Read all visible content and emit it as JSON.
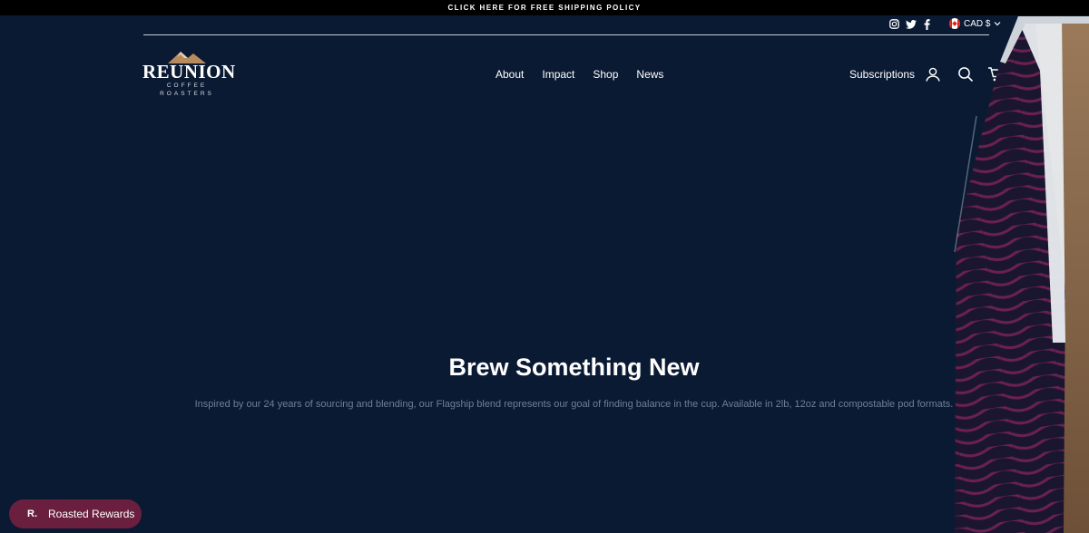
{
  "announcement": {
    "text": "CLICK HERE FOR FREE SHIPPING POLICY"
  },
  "utility": {
    "social": [
      "instagram-icon",
      "twitter-icon",
      "facebook-icon"
    ],
    "currency": "CAD $"
  },
  "logo": {
    "wordmark": "REUNION",
    "line1": "COFFEE",
    "line2": "ROASTERS"
  },
  "nav": {
    "items": [
      {
        "label": "About"
      },
      {
        "label": "Impact"
      },
      {
        "label": "Shop"
      },
      {
        "label": "News"
      }
    ],
    "subscriptions": "Subscriptions"
  },
  "hero": {
    "title": "Brew Something New",
    "subtitle": "Inspired by our 24 years of sourcing and blending, our Flagship blend represents our goal of finding balance in the cup. Available in 2lb, 12oz and compostable pod formats."
  },
  "rewards": {
    "mark": "R.",
    "label": "Roasted Rewards"
  },
  "colors": {
    "background": "#0b1a33",
    "rewards": "#6b1f3f",
    "bag_stripe": "#6b2150"
  }
}
